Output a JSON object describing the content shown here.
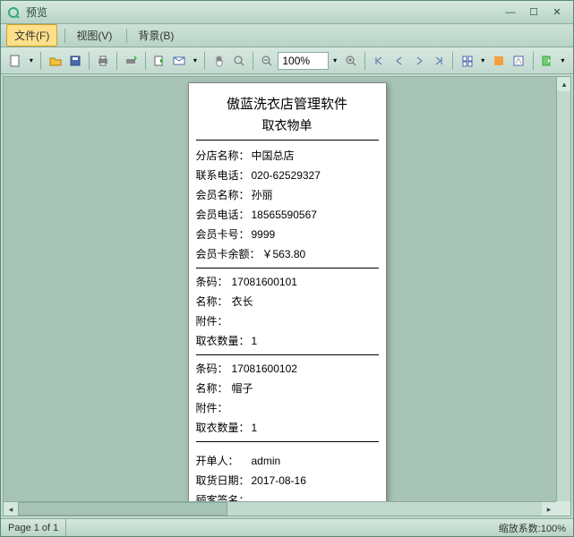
{
  "window": {
    "title": "预览"
  },
  "menu": {
    "file": "文件(F)",
    "view": "视图(V)",
    "background": "背景(B)"
  },
  "toolbar": {
    "zoom": "100%"
  },
  "document": {
    "title": "傲蓝洗衣店管理软件",
    "subtitle": "取衣物单",
    "header": {
      "shop_label": "分店名称：",
      "shop_value": "中国总店",
      "contact_label": "联系电话：",
      "contact_value": "020-62529327",
      "member_name_label": "会员名称：",
      "member_name_value": "孙丽",
      "member_phone_label": "会员电话：",
      "member_phone_value": "18565590567",
      "card_no_label": "会员卡号：",
      "card_no_value": "9999",
      "balance_label": "会员卡余额：",
      "balance_value": "￥563.80"
    },
    "items": [
      {
        "barcode_label": "条码：",
        "barcode_value": "17081600101",
        "name_label": "名称：",
        "name_value": "衣长",
        "attachment_label": "附件：",
        "attachment_value": "",
        "qty_label": "取衣数量：",
        "qty_value": "1"
      },
      {
        "barcode_label": "条码：",
        "barcode_value": "17081600102",
        "name_label": "名称：",
        "name_value": "帽子",
        "attachment_label": "附件：",
        "attachment_value": "",
        "qty_label": "取衣数量：",
        "qty_value": "1"
      }
    ],
    "footer": {
      "operator_label": "开单人：",
      "operator_value": "admin",
      "date_label": "取货日期：",
      "date_value": "2017-08-16",
      "signature_label": "顾客签名：",
      "signature_value": ""
    }
  },
  "status": {
    "page": "Page 1 of 1",
    "zoom": "缩放系数:100%"
  }
}
